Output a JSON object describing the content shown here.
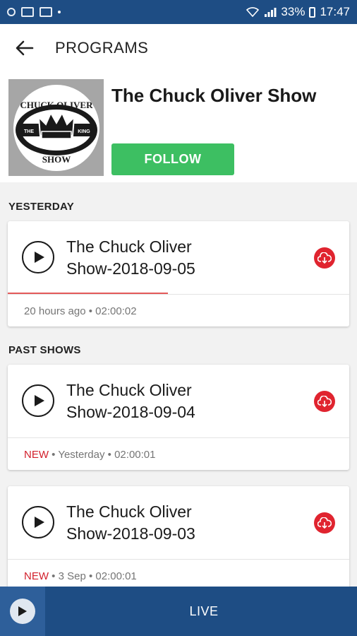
{
  "status_bar": {
    "battery": "33%",
    "time": "17:47"
  },
  "app_bar": {
    "title": "PROGRAMS",
    "back_icon": "arrow-left-icon"
  },
  "program": {
    "title": "The Chuck Oliver Show",
    "follow_label": "FOLLOW",
    "logo_text_top": "CHUCK OLIVER",
    "logo_text_left": "THE",
    "logo_text_right": "KING",
    "logo_text_bottom": "SHOW"
  },
  "sections": {
    "yesterday": "YESTERDAY",
    "past_shows": "PAST SHOWS"
  },
  "episodes": [
    {
      "title_line1": "The Chuck Oliver",
      "title_line2": "Show-2018-09-05",
      "new": "",
      "when": "20 hours ago",
      "duration": "02:00:02",
      "progress": 0.47
    },
    {
      "title_line1": "The Chuck Oliver",
      "title_line2": "Show-2018-09-04",
      "new": "NEW",
      "when": "Yesterday",
      "duration": "02:00:01",
      "progress": 0
    },
    {
      "title_line1": "The Chuck Oliver",
      "title_line2": "Show-2018-09-03",
      "new": "NEW",
      "when": "3 Sep",
      "duration": "02:00:01",
      "progress": 0
    }
  ],
  "bottom": {
    "live_label": "LIVE"
  },
  "colors": {
    "primary": "#1e4d84",
    "follow": "#3dbf62",
    "download": "#e0242f",
    "new_badge": "#d21f2b"
  }
}
